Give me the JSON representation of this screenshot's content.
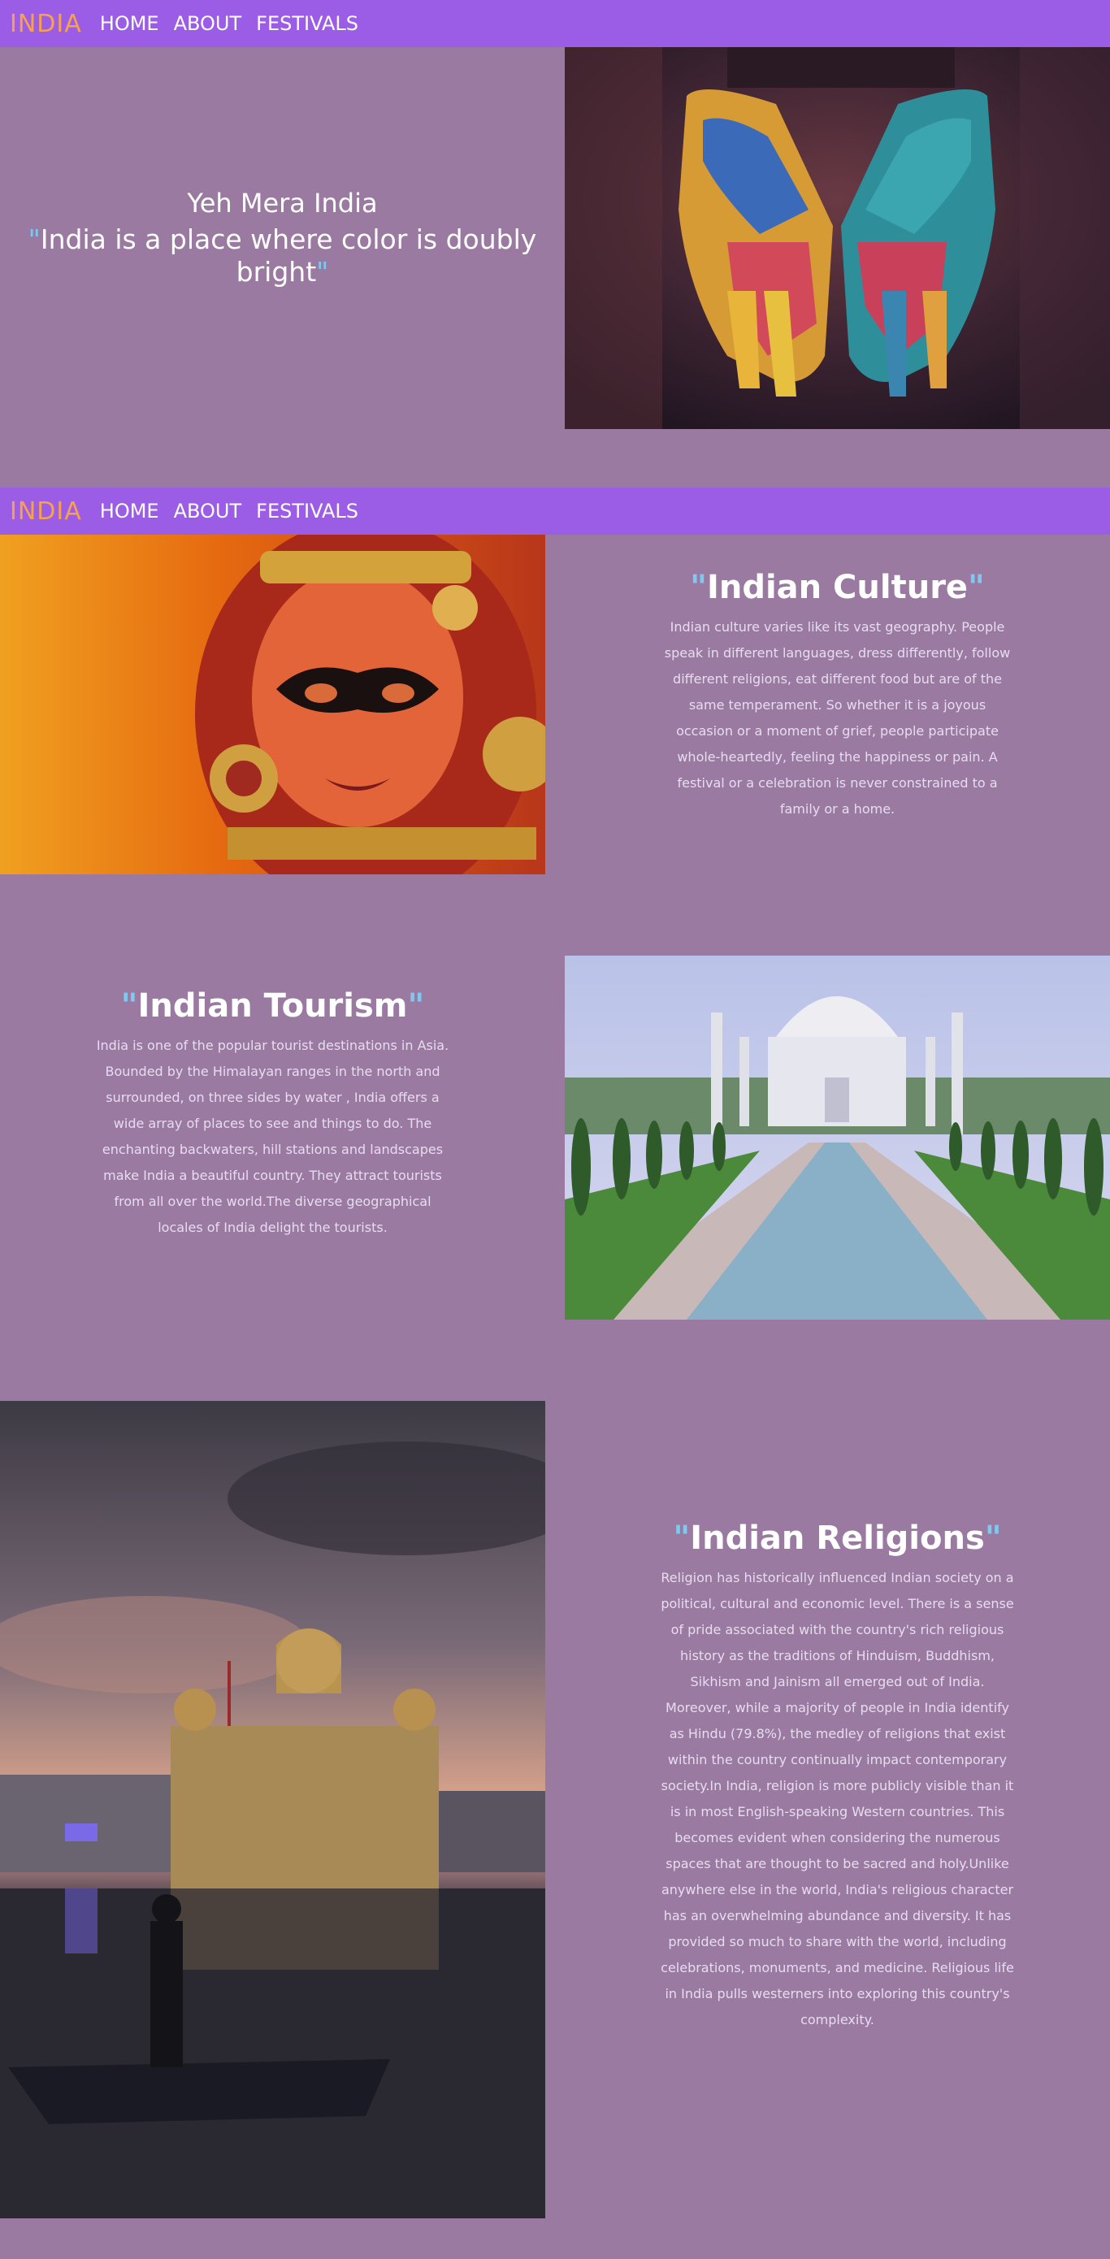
{
  "nav": {
    "brand": "INDIA",
    "links": [
      "HOME",
      "ABOUT",
      "FESTIVALS"
    ]
  },
  "hero": {
    "title": "Yeh Mera India",
    "quote_open": "\"",
    "quote": "India is a place where color is doubly bright",
    "quote_close": "\""
  },
  "sections": {
    "culture": {
      "heading": "Indian Culture",
      "body": "Indian culture varies like its vast geography. People speak in different languages, dress differently, follow different religions, eat different food but are of the same temperament. So whether it is a joyous occasion or a moment of grief, people participate whole-heartedly, feeling the happiness or pain. A festival or a celebration is never constrained to a family or a home."
    },
    "tourism": {
      "heading": "Indian Tourism",
      "body": "India is one of the popular tourist destinations in Asia. Bounded by the Himalayan ranges in the north and surrounded, on three sides by water , India offers a wide array of places to see and things to do. The enchanting backwaters, hill stations and landscapes make India a beautiful country. They attract tourists from all over the world.The diverse geographical locales of India delight the tourists."
    },
    "religions": {
      "heading": "Indian Religions",
      "body": "Religion has historically influenced Indian society on a political, cultural and economic level. There is a sense of pride associated with the country's rich religious history as the traditions of Hinduism, Buddhism, Sikhism and Jainism all emerged out of India. Moreover, while a majority of people in India identify as Hindu (79.8%), the medley of religions that exist within the country continually impact contemporary society.In India, religion is more publicly visible than it is in most English-speaking Western countries. This becomes evident when considering the numerous spaces that are thought to be sacred and holy.Unlike anywhere else in the world, India's religious character has an overwhelming abundance and diversity. It has provided so much to share with the world, including celebrations, monuments, and medicine. Religious life in India pulls westerners into exploring this country's complexity."
    },
    "quote_mark": "\""
  },
  "colors": {
    "background": "#9a7aa0",
    "navbar": "#9b5de5",
    "brand": "#f7a24a",
    "quote_mark": "#7fc8f0"
  }
}
